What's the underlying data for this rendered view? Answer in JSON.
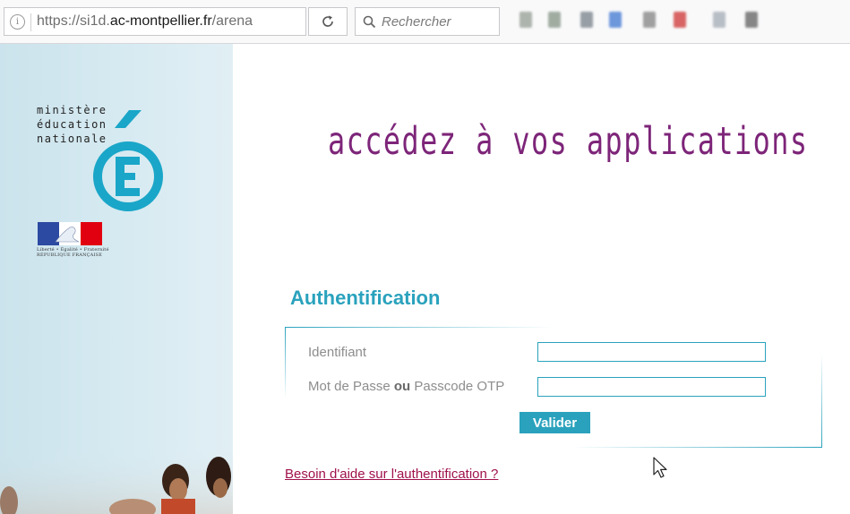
{
  "browser": {
    "url_prefix": "https://si1d.",
    "url_domain": "ac-montpellier.fr",
    "url_path": "/arena",
    "info_icon": "i",
    "reload_icon": "reload-icon",
    "search_placeholder": "Rechercher",
    "extension_colors": [
      "#9aa39a",
      "#8c9a8c",
      "#7f8890",
      "#4a7fd4",
      "#8a8a8a",
      "#d04040",
      "#a8b0b8",
      "#6a6a6a"
    ]
  },
  "logo": {
    "lines": [
      "ministère",
      "éducation",
      "nationale"
    ],
    "flag_caption_line1": "Liberté • Égalité • Fraternité",
    "flag_caption_line2": "RÉPUBLIQUE FRANÇAISE"
  },
  "main": {
    "headline": "accédez à vos applications",
    "auth_title": "Authentification",
    "identifiant_label": "Identifiant",
    "password_label_pre": "Mot de Passe ",
    "password_label_bold": "ou",
    "password_label_post": " Passcode OTP",
    "identifiant_value": "",
    "password_value": "",
    "submit_label": "Valider",
    "help_link": "Besoin d'aide sur l'authentification ?"
  },
  "colors": {
    "accent": "#2aa2bd",
    "headline": "#7d2579",
    "link": "#a0114c"
  }
}
